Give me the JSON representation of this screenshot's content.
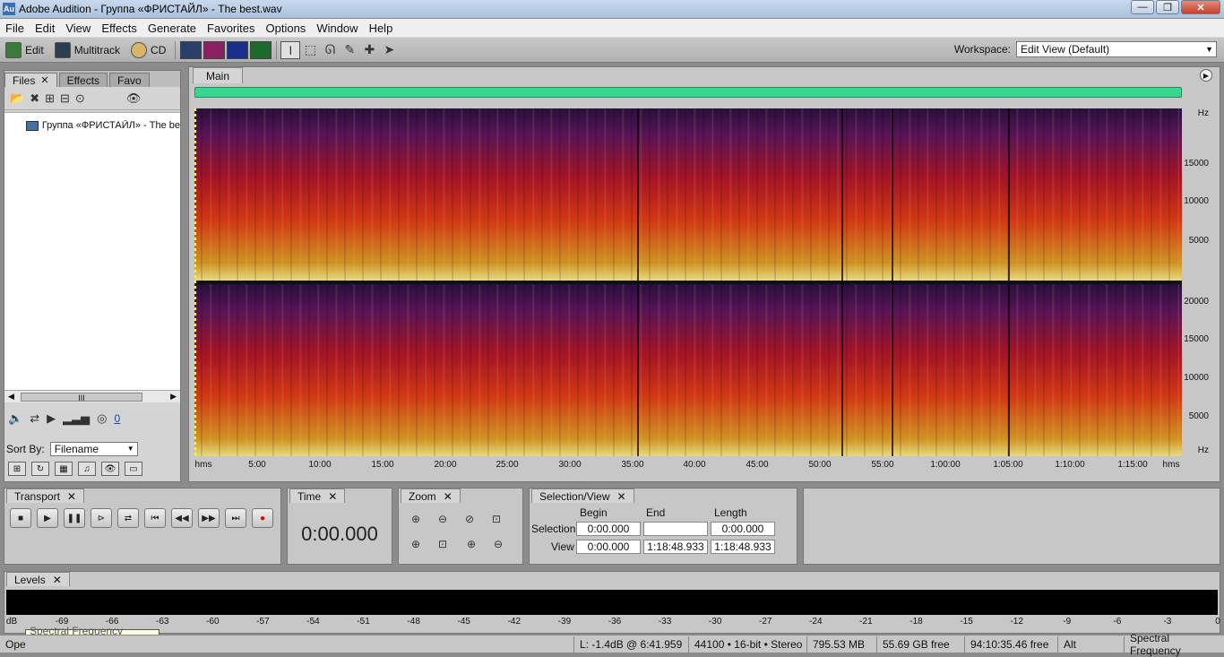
{
  "window": {
    "title": "Adobe Audition - Группа «ФРИСТАЙЛ» - The best.wav",
    "app_icon": "Au"
  },
  "window_controls": {
    "minimize": "—",
    "maximize": "❐",
    "close": "✕"
  },
  "menu": [
    "File",
    "Edit",
    "View",
    "Effects",
    "Generate",
    "Favorites",
    "Options",
    "Window",
    "Help"
  ],
  "toolbar": {
    "edit_label": "Edit",
    "multitrack_label": "Multitrack",
    "cd_label": "CD",
    "workspace_label": "Workspace:",
    "workspace_value": "Edit View (Default)"
  },
  "files_panel": {
    "tabs": [
      "Files",
      "Effects",
      "Favo"
    ],
    "files": [
      "Группа «ФРИСТАЙЛ» - The be"
    ],
    "scroll_label": "III",
    "volume_value": "0",
    "sort_label": "Sort By:",
    "sort_value": "Filename"
  },
  "main_panel": {
    "tab": "Main",
    "y_axis_top": [
      "Hz",
      "15000",
      "10000",
      "5000"
    ],
    "y_axis_bottom": [
      "20000",
      "15000",
      "10000",
      "5000",
      "Hz"
    ],
    "x_axis": [
      "hms",
      "5:00",
      "10:00",
      "15:00",
      "20:00",
      "25:00",
      "30:00",
      "35:00",
      "40:00",
      "45:00",
      "50:00",
      "55:00",
      "1:00:00",
      "1:05:00",
      "1:10:00",
      "1:15:00",
      "hms"
    ]
  },
  "transport": {
    "tab": "Transport"
  },
  "time": {
    "tab": "Time",
    "value": "0:00.000"
  },
  "zoom": {
    "tab": "Zoom"
  },
  "selection_view": {
    "tab": "Selection/View",
    "headers": [
      "Begin",
      "End",
      "Length"
    ],
    "row_labels": [
      "Selection",
      "View"
    ],
    "selection": {
      "begin": "0:00.000",
      "end": "",
      "length": "0:00.000"
    },
    "view": {
      "begin": "0:00.000",
      "end": "1:18:48.933",
      "length": "1:18:48.933"
    }
  },
  "levels": {
    "tab": "Levels",
    "scale": [
      "dB",
      "-69",
      "-66",
      "-63",
      "-60",
      "-57",
      "-54",
      "-51",
      "-48",
      "-45",
      "-42",
      "-39",
      "-36",
      "-33",
      "-30",
      "-27",
      "-24",
      "-21",
      "-18",
      "-15",
      "-12",
      "-9",
      "-6",
      "-3",
      "0"
    ]
  },
  "tooltip": "Spectral Frequency Display",
  "status": {
    "left": "Ope",
    "level": "L: -1.4dB @  6:41.959",
    "format": "44100 • 16-bit • Stereo",
    "size": "795.53 MB",
    "free": "55.69 GB free",
    "time_free": "94:10:35.46 free",
    "key": "Alt",
    "mode": "Spectral Frequency"
  },
  "colors": {
    "overview": "#38d68f",
    "spectrogram_low": "#ffe88a",
    "spectrogram_mid": "#e03c1a",
    "spectrogram_high": "#2a0f3c"
  }
}
